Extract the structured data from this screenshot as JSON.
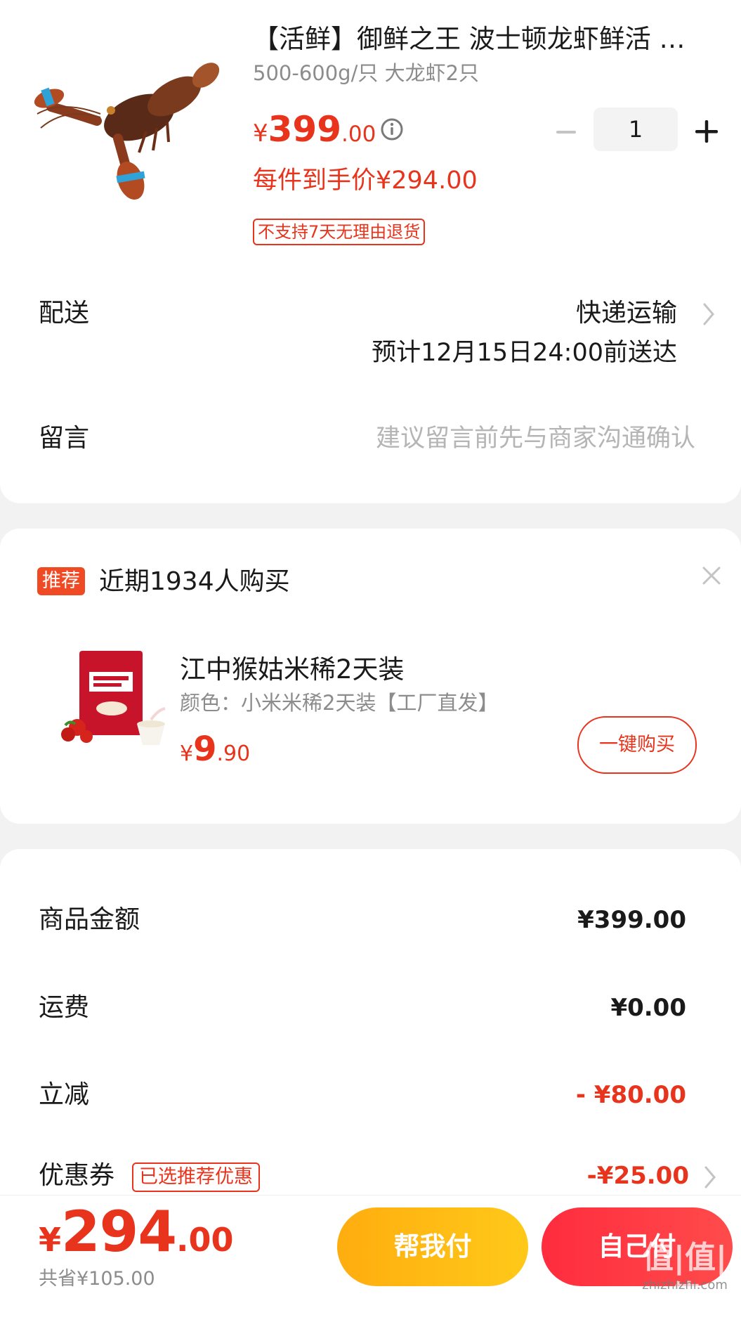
{
  "product": {
    "title": "【活鲜】御鲜之王 波士顿龙虾鲜活 …",
    "sku": "500-600g/只 大龙虾2只",
    "price_symbol": "¥",
    "price_int": "399",
    "price_dec": ".00",
    "quantity": "1",
    "each_price": "每件到手价¥294.00",
    "return_tag": "不支持7天无理由退货",
    "image_icon": "lobster-image"
  },
  "delivery": {
    "label": "配送",
    "mode": "快递运输",
    "eta": "预计12月15日24:00前送达"
  },
  "note": {
    "label": "留言",
    "placeholder": "建议留言前先与商家沟通确认"
  },
  "recommend": {
    "badge": "推荐",
    "title": "近期1934人购买",
    "name": "江中猴姑米稀2天装",
    "spec": "颜色：小米米稀2天装【工厂直发】",
    "price_symbol": "¥",
    "price_int": "9",
    "price_dec": ".90",
    "buy_label": "一键购买"
  },
  "summary": {
    "goods_label": "商品金额",
    "goods_value": "¥399.00",
    "shipping_label": "运费",
    "shipping_value": "¥0.00",
    "discount_label": "立减",
    "discount_value": "- ¥80.00",
    "coupon_label": "优惠券",
    "coupon_tag": "已选推荐优惠",
    "coupon_value": "-¥25.00"
  },
  "footer": {
    "total_symbol": "¥",
    "total_int": "294",
    "total_dec": ".00",
    "saved": "共省¥105.00",
    "help_pay_label": "帮我付",
    "self_pay_label": "自己付",
    "watermark_main": "值|值|值",
    "watermark_sub": "zhizhizhi.com"
  },
  "colors": {
    "accent_red": "#e8341c",
    "pay_orange": "#ffb812",
    "pay_red": "#ff3344"
  }
}
